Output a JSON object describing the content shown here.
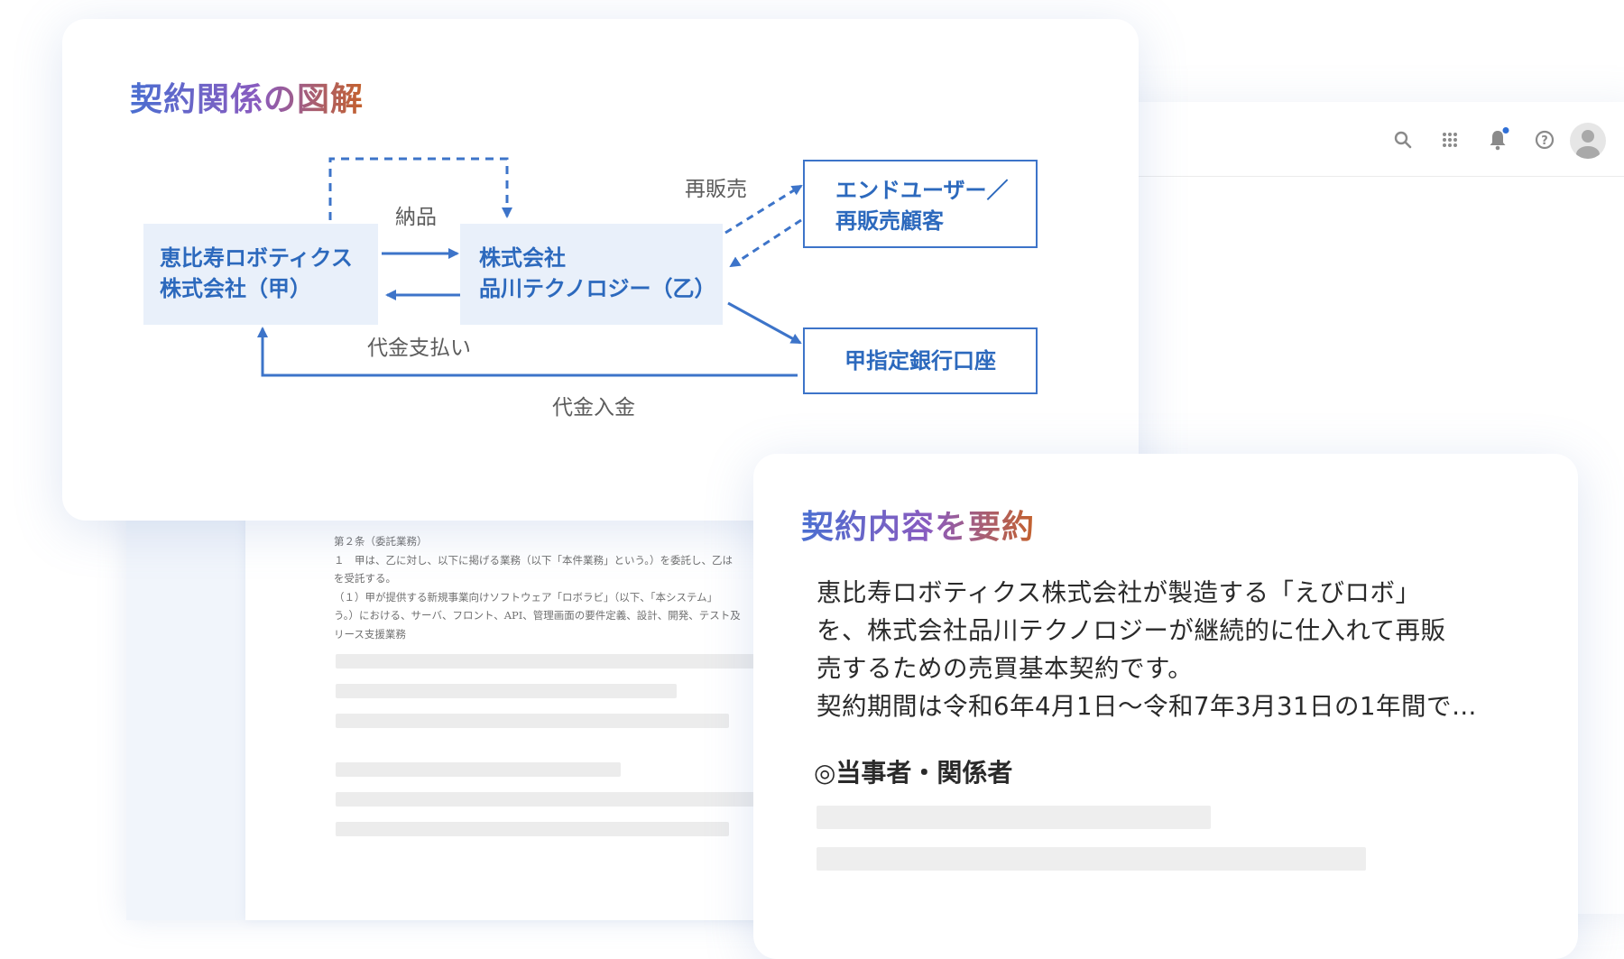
{
  "diagram": {
    "title": "契約関係の図解",
    "nodes": {
      "party_a": [
        "恵比寿ロボティクス",
        "株式会社（甲）"
      ],
      "party_b": [
        "株式会社",
        "品川テクノロジー（乙）"
      ],
      "end_user": [
        "エンドユーザー／",
        "再販売顧客"
      ],
      "bank": [
        "甲指定銀行口座"
      ]
    },
    "edges": {
      "delivery": "納品",
      "payment": "代金支払い",
      "resale": "再販売",
      "deposit": "代金入金"
    }
  },
  "document": {
    "lines": [
      "第２条（委託業務）",
      "１　甲は、乙に対し、以下に掲げる業務（以下「本件業務」という。）を委託し、乙は",
      "を受託する。",
      "（１）甲が提供する新規事業向けソフトウェア「ロボラビ」（以下、「本システム」",
      "う。）における、サーバ、フロント、API、管理画面の要件定義、設計、開発、テスト及",
      "リース支援業務"
    ]
  },
  "summary": {
    "title": "契約内容を要約",
    "body_lines": [
      "恵比寿ロボティクス株式会社が製造する「えびロボ」",
      "を、株式会社品川テクノロジーが継続的に仕入れて再販",
      "売するための売買基本契約です。",
      "契約期間は令和6年4月1日〜令和7年3月31日の1年間で…"
    ],
    "parties_heading": "◎当事者・関係者"
  },
  "toolbar": {
    "icons": [
      "search-icon",
      "apps-grid-icon",
      "bell-icon",
      "help-icon",
      "avatar"
    ],
    "notification_dot_color": "#2f6fd6"
  },
  "colors": {
    "accent_blue": "#3d74c9",
    "node_fill": "#e9f0fa",
    "title_gradient": [
      "#4a6fd1",
      "#8a5bbf",
      "#c4612c"
    ]
  }
}
